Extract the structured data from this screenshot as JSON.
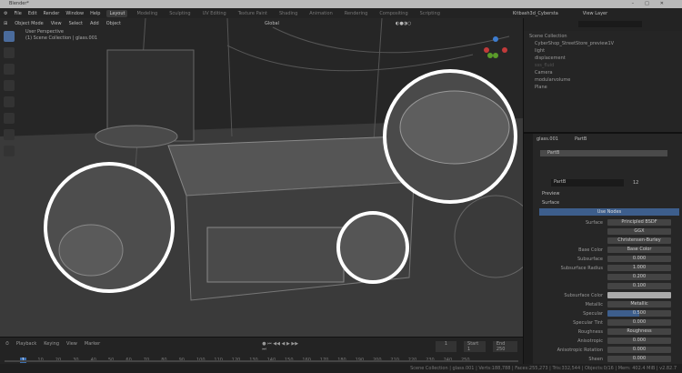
{
  "window": {
    "title": "Blender*"
  },
  "menu": {
    "items": [
      "File",
      "Edit",
      "Render",
      "Window",
      "Help"
    ],
    "workspaces": [
      "Layout",
      "Modeling",
      "Sculpting",
      "UV Editing",
      "Texture Paint",
      "Shading",
      "Animation",
      "Rendering",
      "Compositing",
      "Scripting"
    ],
    "active_workspace": "Layout"
  },
  "scene": {
    "name": "Kitbash3d_Cybersta",
    "view_layer": "View Layer"
  },
  "viewport": {
    "mode": "Object Mode",
    "menus": [
      "View",
      "Select",
      "Add",
      "Object"
    ],
    "transform": "Global",
    "info_line1": "User Perspective",
    "info_line2": "(1) Scene Collection | glass.001"
  },
  "outliner": {
    "root": "Scene Collection",
    "items": [
      "CyberShop_StreetStore_preview1V",
      "light",
      "displacement",
      "sss_fluid",
      "Camera",
      "modularvolume",
      "Plane"
    ]
  },
  "properties": {
    "object": "glass.001",
    "material": "PartB",
    "slot": "PartB",
    "material_name": "PartB",
    "users": "12",
    "sections": [
      "Preview",
      "Surface"
    ],
    "use_nodes": "Use Nodes",
    "rows": [
      {
        "label": "Surface",
        "value": "Principled BSDF"
      },
      {
        "label": "",
        "value": "GGX"
      },
      {
        "label": "",
        "value": "Christensen-Burley"
      },
      {
        "label": "Base Color",
        "value": "Base Color"
      },
      {
        "label": "Subsurface",
        "value": "0.000"
      },
      {
        "label": "Subsurface Radius",
        "value": "1.000"
      },
      {
        "label": "",
        "value": "0.200"
      },
      {
        "label": "",
        "value": "0.100"
      },
      {
        "label": "Subsurface Color",
        "value": ""
      },
      {
        "label": "Metallic",
        "value": "Metallic"
      },
      {
        "label": "Specular",
        "value": "0.500"
      },
      {
        "label": "Specular Tint",
        "value": "0.000"
      },
      {
        "label": "Roughness",
        "value": "Roughness"
      },
      {
        "label": "Anisotropic",
        "value": "0.000"
      },
      {
        "label": "Anisotropic Rotation",
        "value": "0.000"
      },
      {
        "label": "Sheen",
        "value": "0.000"
      }
    ]
  },
  "timeline": {
    "menus": [
      "Playback",
      "Keying",
      "View",
      "Marker"
    ],
    "current_frame": "1",
    "start_label": "Start",
    "start": "1",
    "end_label": "End",
    "end": "250",
    "ticks": [
      "1",
      "10",
      "20",
      "30",
      "40",
      "50",
      "60",
      "70",
      "80",
      "90",
      "100",
      "110",
      "120",
      "130",
      "140",
      "150",
      "160",
      "170",
      "180",
      "190",
      "200",
      "210",
      "220",
      "230",
      "240",
      "250"
    ]
  },
  "status": {
    "text": "Scene Collection | glass.001 | Verts:188,788 | Faces:255,273 | Tris:332,544 | Objects:0/16 | Mem: 402.4 MiB | v2.82.7"
  }
}
